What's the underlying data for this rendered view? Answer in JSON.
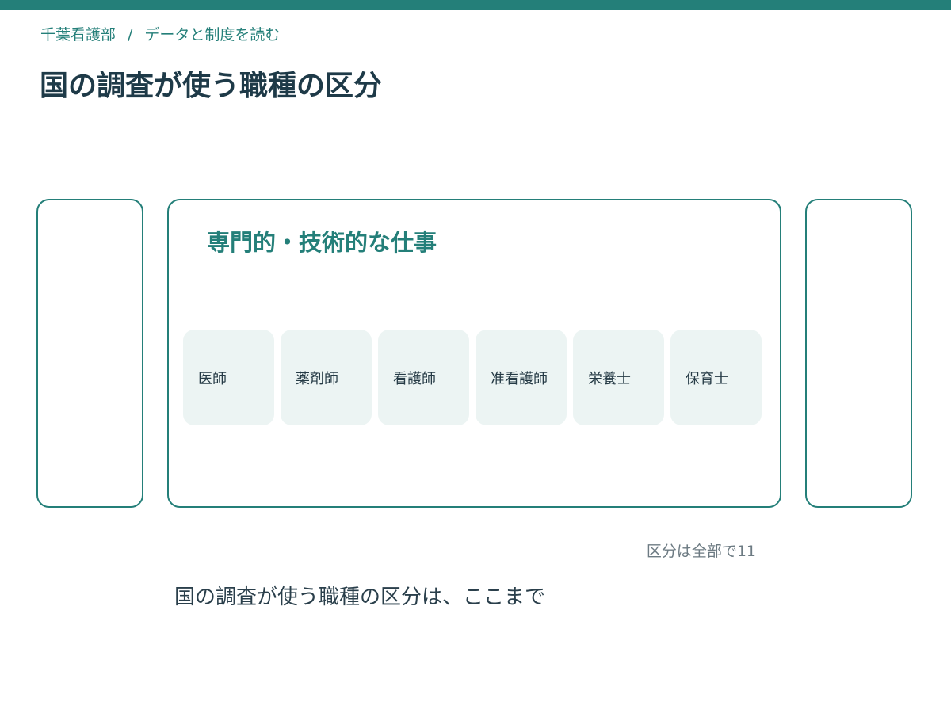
{
  "header": {
    "breadcrumb": {
      "section": "千葉看護部",
      "separator": "/",
      "page": "データと制度を読む"
    },
    "title": "国の調査が使う職種の区分"
  },
  "carousel": {
    "current_card": {
      "category_title": "専門的・技術的な仕事",
      "occupations": [
        {
          "label": "医師"
        },
        {
          "label": "薬剤師"
        },
        {
          "label": "看護師"
        },
        {
          "label": "准看護師"
        },
        {
          "label": "栄養士"
        },
        {
          "label": "保育士"
        }
      ]
    },
    "total_label": "区分は全部で11"
  },
  "footer": {
    "closing_text": "国の調査が使う職種の区分は、ここまで"
  },
  "colors": {
    "accent": "#247f79",
    "title": "#1e3a48",
    "tile_background": "#ecf4f3",
    "muted_text": "#6d7b83"
  }
}
